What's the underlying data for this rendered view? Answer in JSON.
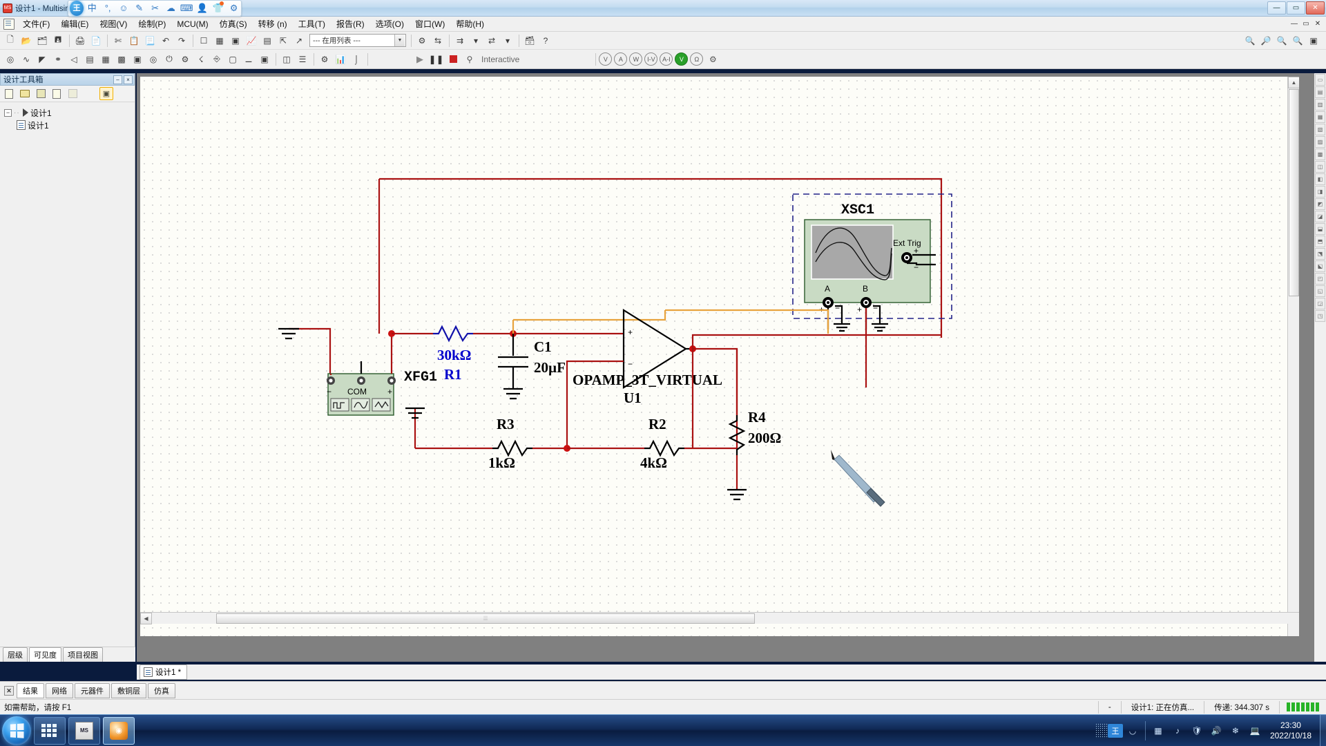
{
  "window": {
    "title": "设计1 - Multisim",
    "minimize": "—",
    "maximize": "▭",
    "close": "✕"
  },
  "ime": {
    "logo": "王",
    "items": [
      "中",
      "°,",
      "☺",
      "✎",
      "✂",
      "☁",
      "⌨",
      "👤",
      "👕",
      "⚙"
    ]
  },
  "menu": {
    "items": [
      "文件(F)",
      "编辑(E)",
      "视图(V)",
      "绘制(P)",
      "MCU(M)",
      "仿真(S)",
      "转移 (n)",
      "工具(T)",
      "报告(R)",
      "选项(O)",
      "窗口(W)",
      "帮助(H)"
    ],
    "right_buttons": [
      "—",
      "▭",
      "✕"
    ]
  },
  "toolbar_main": {
    "groups": [
      [
        "new-file",
        "open-file",
        "open-sample",
        "save-file"
      ],
      [
        "print",
        "print-preview"
      ],
      [
        "cut",
        "copy",
        "paste",
        "undo",
        "redo"
      ],
      [
        "full-screen",
        "spreadsheet-view",
        "design-toolbox",
        "grapher",
        "postprocessor"
      ],
      [
        "parent-sheet",
        "zoom-area"
      ]
    ],
    "select_box": {
      "value": "--- 在用列表 ---",
      "arrow": "▼"
    },
    "right_group": [
      "erc",
      "back-annotate",
      "forward-annotate",
      "help"
    ],
    "zoom_group": [
      "zoom-in",
      "zoom-out",
      "zoom-fit",
      "zoom-area",
      "zoom-selection"
    ]
  },
  "toolbar_sim": {
    "play": "▶",
    "pause": "❚❚",
    "stop": "■",
    "mode_icon": "⚲",
    "mode_label": "Interactive",
    "probes": [
      "V",
      "A",
      "W",
      "I-V",
      "A-I",
      "V",
      "Ω",
      "⚙"
    ]
  },
  "design_toolbox": {
    "title": "设计工具箱",
    "minimize": "–",
    "close": "×",
    "tools": [
      "new-design",
      "open-design",
      "save-design",
      "close-design",
      "rename",
      "properties"
    ],
    "tree": [
      {
        "label": "设计1",
        "level": 0
      },
      {
        "label": "设计1",
        "level": 1
      }
    ],
    "tabs": [
      {
        "label": "层级",
        "active": false
      },
      {
        "label": "可见度",
        "active": true
      },
      {
        "label": "项目视图",
        "active": false
      }
    ]
  },
  "sheet_tab": {
    "label": "设计1 *"
  },
  "spreadsheet": {
    "close": "✕",
    "tabs": [
      {
        "label": "结果",
        "active": true
      },
      {
        "label": "网络",
        "active": false
      },
      {
        "label": "元器件",
        "active": false
      },
      {
        "label": "敷铜层",
        "active": false
      },
      {
        "label": "仿真",
        "active": false
      }
    ]
  },
  "statusbar": {
    "hint": "如需帮助，请按 F1",
    "dash": "-",
    "design_status": "设计1: 正在仿真...",
    "transfer": "传递: 344.307 s"
  },
  "taskbar": {
    "clock_time": "23:30",
    "clock_date": "2022/10/18",
    "tray_ime": "王",
    "tray_icons": [
      "nvidia-icon",
      "audio-driver-icon",
      "shield-icon",
      "volume-icon",
      "flower-icon",
      "network-icon"
    ],
    "apps": [
      {
        "name": "show-desktop-tile",
        "icon": "grid"
      },
      {
        "name": "multisim-taskbar-icon",
        "icon": "MS",
        "active": false
      },
      {
        "name": "active-app-icon",
        "icon": "◉",
        "active": true
      }
    ]
  },
  "schematic": {
    "components": [
      {
        "ref": "XFG1",
        "label": "XFG1",
        "type": "function-generator",
        "terminals": [
          "−",
          "COM",
          "+"
        ]
      },
      {
        "ref": "R1",
        "label": "R1",
        "value": "30kΩ",
        "type": "resistor",
        "color": "#0000cc"
      },
      {
        "ref": "C1",
        "label": "C1",
        "value": "20µF",
        "type": "capacitor"
      },
      {
        "ref": "U1",
        "label": "U1",
        "value": "OPAMP_3T_VIRTUAL",
        "type": "opamp",
        "pins": [
          "+",
          "−"
        ]
      },
      {
        "ref": "R2",
        "label": "R2",
        "value": "4kΩ",
        "type": "resistor"
      },
      {
        "ref": "R3",
        "label": "R3",
        "value": "1kΩ",
        "type": "resistor"
      },
      {
        "ref": "R4",
        "label": "R4",
        "value": "200Ω",
        "type": "resistor"
      },
      {
        "ref": "XSC1",
        "label": "XSC1",
        "type": "oscilloscope",
        "channels": [
          "A",
          "B"
        ],
        "ext_trig": "Ext Trig",
        "polarity": [
          "+",
          "−"
        ]
      }
    ],
    "colors": {
      "wire": "#aa1111",
      "wire_orange": "#e8a33d",
      "component": "#000000",
      "r1_text": "#0000cc",
      "scope_body": "#c9dbc4",
      "scope_screen": "#a8a8a8",
      "generator_body": "#c9dbc4",
      "selection_dash": "#222288"
    }
  }
}
